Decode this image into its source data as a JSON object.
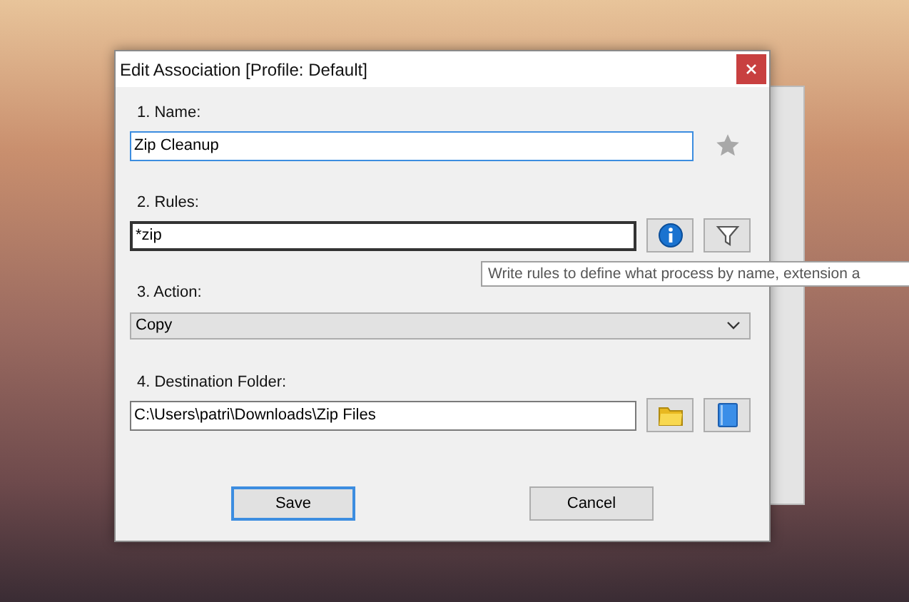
{
  "window": {
    "title": "Edit Association [Profile: Default]"
  },
  "fields": [
    {
      "kind": "text",
      "label": "1. Name:",
      "value": "Zip Cleanup",
      "focused": true,
      "hovered": false,
      "tools": [
        {
          "kind": "star"
        }
      ]
    },
    {
      "kind": "text",
      "label": "2. Rules:",
      "value": "*zip",
      "focused": false,
      "hovered": true,
      "tools": [
        {
          "kind": "info"
        },
        {
          "kind": "filter"
        }
      ]
    },
    {
      "kind": "select",
      "label": "3. Action:",
      "value": "Copy",
      "focused": false,
      "hovered": false
    },
    {
      "kind": "text",
      "label": "4. Destination Folder:",
      "value": "C:\\Users\\patri\\Downloads\\Zip Files",
      "focused": false,
      "hovered": false,
      "tools": [
        {
          "kind": "folder"
        },
        {
          "kind": "book"
        }
      ]
    }
  ],
  "tooltip": {
    "text": "Write rules to define what process by name, extension a"
  },
  "buttons": [
    {
      "label": "Save",
      "default": true
    },
    {
      "label": "Cancel",
      "default": false
    }
  ]
}
